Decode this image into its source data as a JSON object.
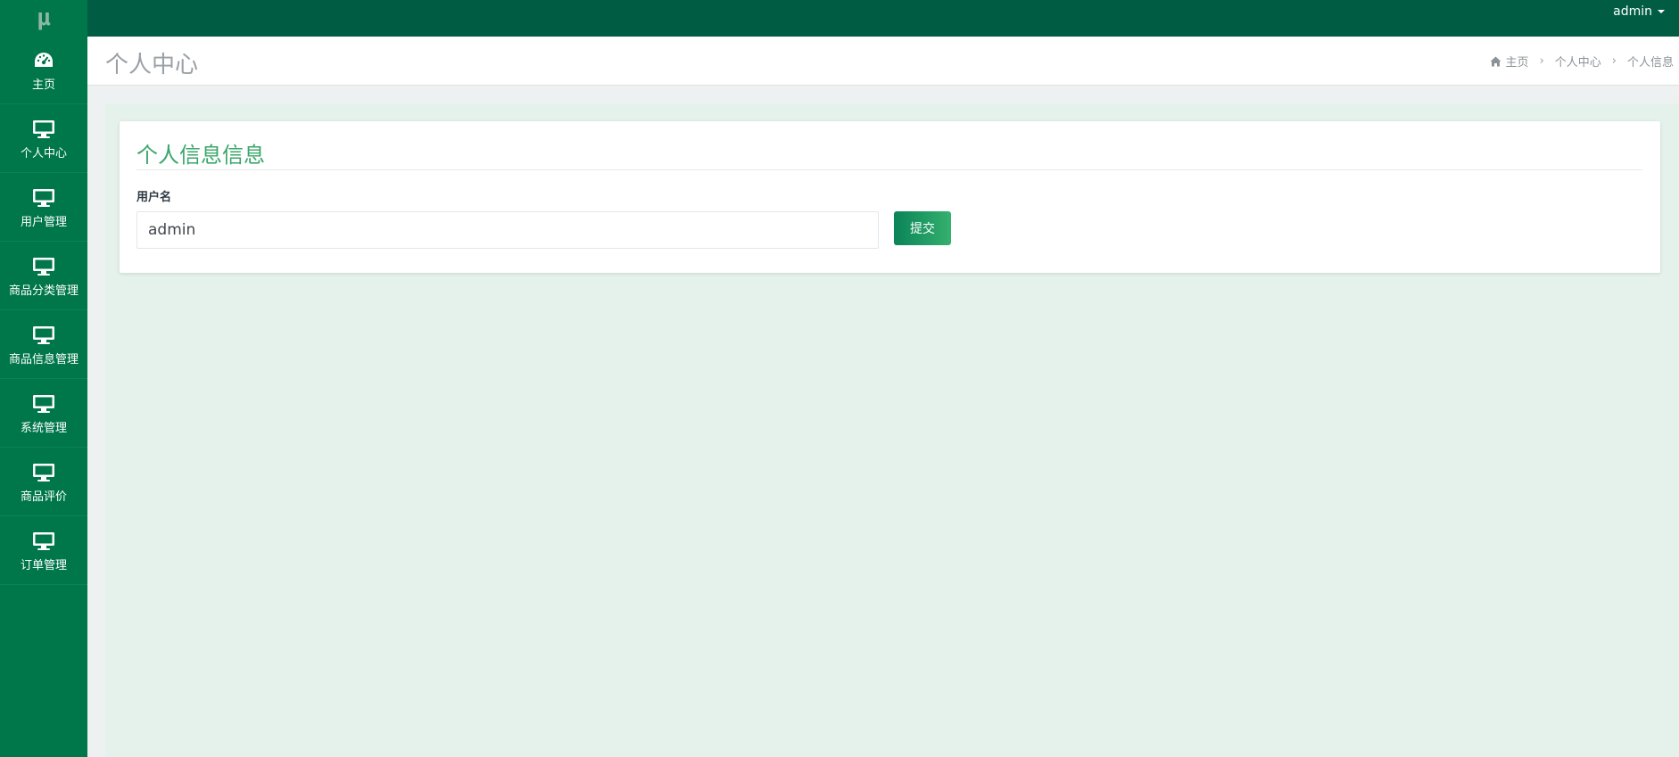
{
  "app": {
    "logo_text": "μ"
  },
  "topbar": {
    "user_name": "admin"
  },
  "sidebar": {
    "items": [
      {
        "label": "主页",
        "icon": "dashboard-icon"
      },
      {
        "label": "个人中心",
        "icon": "monitor-icon"
      },
      {
        "label": "用户管理",
        "icon": "monitor-icon"
      },
      {
        "label": "商品分类管理",
        "icon": "monitor-icon"
      },
      {
        "label": "商品信息管理",
        "icon": "monitor-icon"
      },
      {
        "label": "系统管理",
        "icon": "monitor-icon"
      },
      {
        "label": "商品评价",
        "icon": "monitor-icon"
      },
      {
        "label": "订单管理",
        "icon": "monitor-icon"
      }
    ]
  },
  "header": {
    "title": "个人中心",
    "breadcrumb": [
      "主页",
      "个人中心",
      "个人信息"
    ]
  },
  "card": {
    "title": "个人信息信息",
    "username_label": "用户名",
    "username_value": "admin",
    "submit_label": "提交"
  },
  "colors": {
    "sidebar_bg": "#00774b",
    "topbar_bg": "#005d43",
    "accent": "#3aa66a"
  }
}
